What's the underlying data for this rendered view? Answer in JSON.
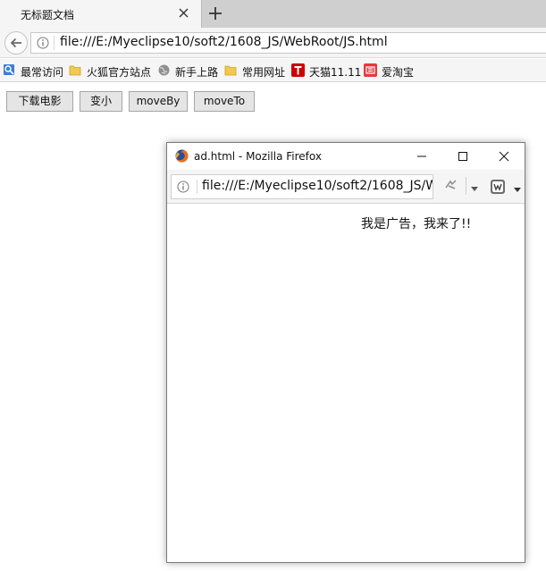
{
  "browser": {
    "tab": {
      "title": "无标题文档"
    },
    "url": "file:///E:/Myeclipse10/soft2/1608_JS/WebRoot/JS.html",
    "bookmarks": [
      {
        "label": "最常访问",
        "icon": "most-visited-icon"
      },
      {
        "label": "火狐官方站点",
        "icon": "folder-icon"
      },
      {
        "label": "新手上路",
        "icon": "globe-icon"
      },
      {
        "label": "常用网址",
        "icon": "folder-icon"
      },
      {
        "label": "天猫11.11",
        "icon": "tmall-icon"
      },
      {
        "label": "爱淘宝",
        "icon": "taobao-icon"
      }
    ]
  },
  "page": {
    "buttons": [
      {
        "label": "下载电影"
      },
      {
        "label": "变小"
      },
      {
        "label": "moveBy"
      },
      {
        "label": "moveTo"
      }
    ]
  },
  "popup": {
    "title": "ad.html - Mozilla Firefox",
    "url": "file:///E:/Myeclipse10/soft2/1608_JS/W",
    "ad_text": "我是广告，我来了!!"
  },
  "colors": {
    "tabstrip": "#cfcfcf",
    "toolbar": "#f5f5f5",
    "button_bg": "#e5e5e5",
    "tmall_red": "#cc0000",
    "folder_yellow": "#f2c94c"
  }
}
